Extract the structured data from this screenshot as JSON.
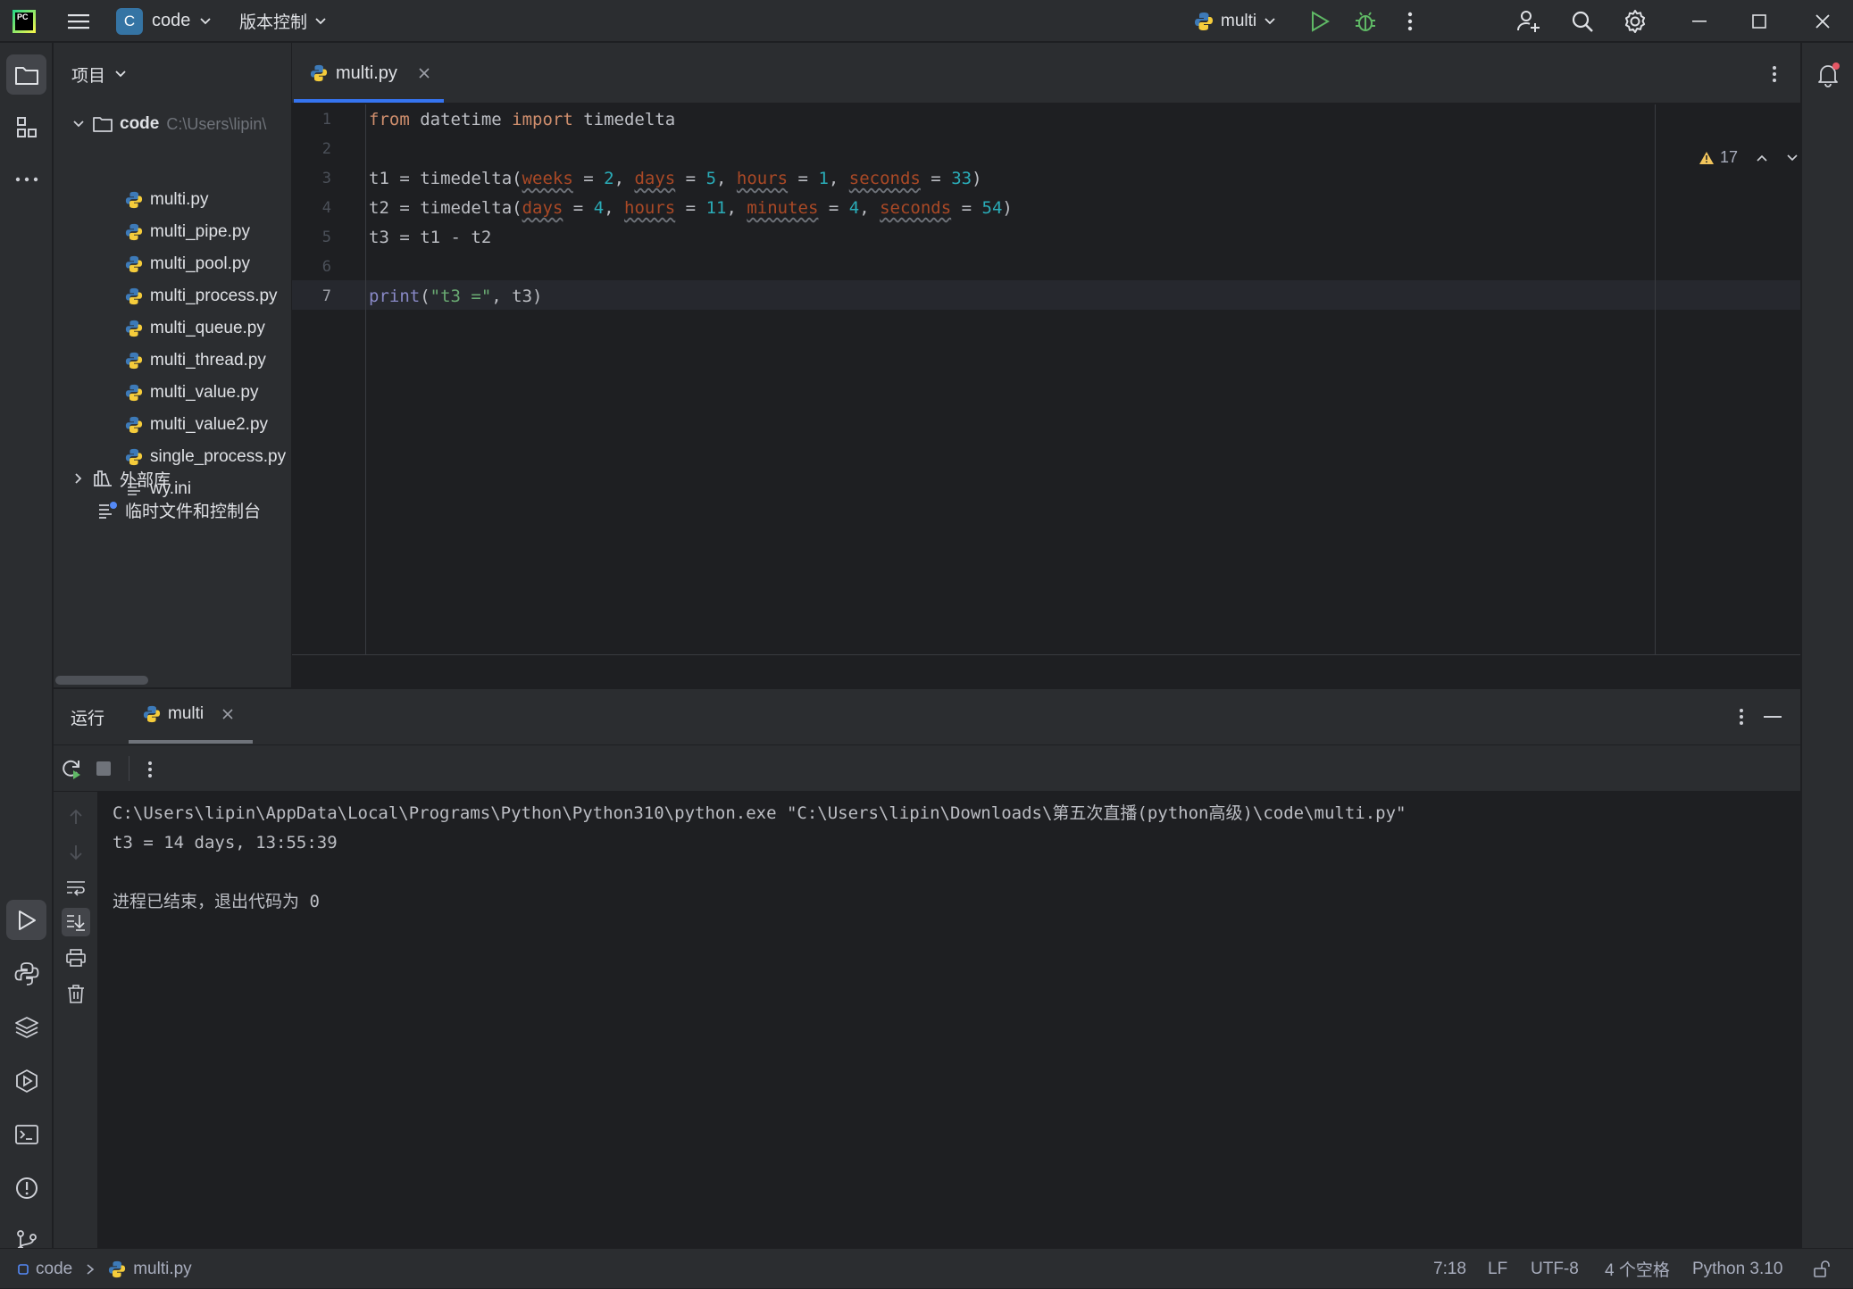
{
  "titlebar": {
    "logo": "PC",
    "menu_icon": "hamburger-icon",
    "project_badge": "C",
    "project_name": "code",
    "vcs_label": "版本控制",
    "run_config": "multi"
  },
  "project_panel": {
    "title": "项目",
    "root_name": "code",
    "root_path": "C:\\Users\\lipin\\",
    "files": [
      "multi.py",
      "multi_pipe.py",
      "multi_pool.py",
      "multi_process.py",
      "multi_queue.py",
      "multi_thread.py",
      "multi_value.py",
      "multi_value2.py",
      "single_process.py",
      "wy.ini"
    ],
    "external_libs": "外部库",
    "scratches": "临时文件和控制台"
  },
  "editor": {
    "tab_label": "multi.py",
    "warnings_count": "17",
    "current_line": "7",
    "lines": [
      {
        "n": "1",
        "tokens": [
          {
            "t": "from",
            "c": "kw"
          },
          {
            "t": " datetime "
          },
          {
            "t": "import",
            "c": "kw"
          },
          {
            "t": " timedelta"
          }
        ]
      },
      {
        "n": "2",
        "tokens": []
      },
      {
        "n": "3",
        "tokens": [
          {
            "t": "t1 = timedelta("
          },
          {
            "t": "weeks",
            "c": "param"
          },
          {
            "t": " = "
          },
          {
            "t": "2",
            "c": "num"
          },
          {
            "t": ", "
          },
          {
            "t": "days",
            "c": "param"
          },
          {
            "t": " = "
          },
          {
            "t": "5",
            "c": "num"
          },
          {
            "t": ", "
          },
          {
            "t": "hours",
            "c": "param"
          },
          {
            "t": " = "
          },
          {
            "t": "1",
            "c": "num"
          },
          {
            "t": ", "
          },
          {
            "t": "seconds",
            "c": "param"
          },
          {
            "t": " = "
          },
          {
            "t": "33",
            "c": "num"
          },
          {
            "t": ")"
          }
        ]
      },
      {
        "n": "4",
        "tokens": [
          {
            "t": "t2 = timedelta("
          },
          {
            "t": "days",
            "c": "param"
          },
          {
            "t": " = "
          },
          {
            "t": "4",
            "c": "num"
          },
          {
            "t": ", "
          },
          {
            "t": "hours",
            "c": "param"
          },
          {
            "t": " = "
          },
          {
            "t": "11",
            "c": "num"
          },
          {
            "t": ", "
          },
          {
            "t": "minutes",
            "c": "param"
          },
          {
            "t": " = "
          },
          {
            "t": "4",
            "c": "num"
          },
          {
            "t": ", "
          },
          {
            "t": "seconds",
            "c": "param"
          },
          {
            "t": " = "
          },
          {
            "t": "54",
            "c": "num"
          },
          {
            "t": ")"
          }
        ]
      },
      {
        "n": "5",
        "tokens": [
          {
            "t": "t3 = t1 - t2"
          }
        ]
      },
      {
        "n": "6",
        "tokens": []
      },
      {
        "n": "7",
        "tokens": [
          {
            "t": "print",
            "c": "bi"
          },
          {
            "t": "("
          },
          {
            "t": "\"t3 =\"",
            "c": "str"
          },
          {
            "t": ", t3)"
          }
        ]
      }
    ]
  },
  "run_panel": {
    "tab_run": "运行",
    "tab_config": "multi",
    "output": [
      "C:\\Users\\lipin\\AppData\\Local\\Programs\\Python\\Python310\\python.exe \"C:\\Users\\lipin\\Downloads\\第五次直播(python高级)\\code\\multi.py\"",
      "t3 = 14 days, 13:55:39",
      "",
      "进程已结束，退出代码为 0"
    ]
  },
  "statusbar": {
    "crumb_root": "code",
    "crumb_file": "multi.py",
    "position": "7:18",
    "line_sep": "LF",
    "encoding": "UTF-8",
    "indent": "4 个空格",
    "interpreter": "Python 3.10"
  }
}
